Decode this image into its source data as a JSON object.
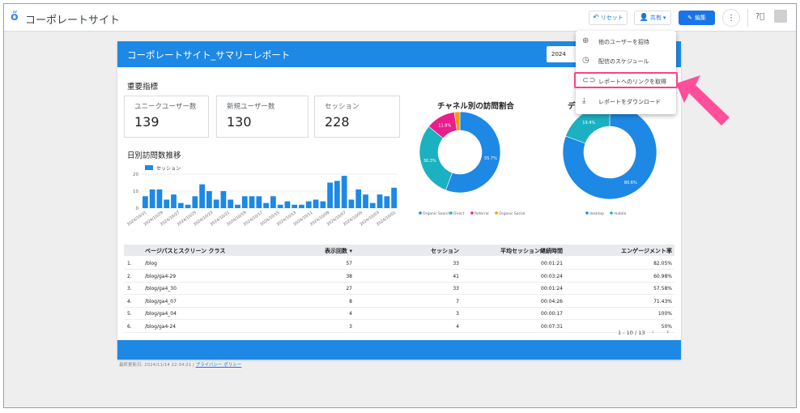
{
  "app": {
    "title": "コーポレートサイト"
  },
  "toolbar": {
    "reset_label": "リセット",
    "share_label": "共有",
    "edit_label": "編集"
  },
  "report": {
    "title": "コーポレートサイト_サマリーレポート",
    "date_prefix": "2024",
    "kpi_section": "重要指標",
    "kpis": [
      {
        "label": "ユニークユーザー数",
        "value": "139"
      },
      {
        "label": "新規ユーザー数",
        "value": "130"
      },
      {
        "label": "セッション",
        "value": "228"
      }
    ],
    "daily_title": "日別訪問数推移",
    "channel_title": "チャネル別の訪問割合",
    "device_title_partial": "デ",
    "last_updated": "最終更新日: 2024/11/14 22:34:21",
    "privacy_link": "プライバシー ポリシー"
  },
  "chart_data": [
    {
      "type": "bar",
      "title": "日別訪問数推移",
      "legend": [
        "セッション"
      ],
      "ylim": [
        0,
        20
      ],
      "yticks": [
        0,
        10,
        20
      ],
      "x_tick_labels": [
        "2024/10/31",
        "2024/10/29",
        "2024/10/27",
        "2024/10/25",
        "2024/10/23",
        "2024/10/21",
        "2024/10/19",
        "2024/10/17",
        "2024/10/15",
        "2024/10/13",
        "2024/10/11",
        "2024/10/09",
        "2024/10/07",
        "2024/10/05",
        "2024/10/03",
        "2024/10/01"
      ],
      "values": [
        7,
        11,
        11,
        5,
        8,
        3,
        2,
        7,
        14,
        10,
        5,
        10,
        5,
        2,
        7,
        7,
        7,
        3,
        7,
        2,
        4,
        2,
        2,
        4,
        5,
        4,
        15,
        16,
        19,
        5,
        11,
        8,
        3,
        8,
        7,
        12
      ],
      "color": "#1e88e5"
    },
    {
      "type": "pie",
      "title": "チャネル別の訪問割合",
      "labels": [
        "Organic Search",
        "Direct",
        "Referral",
        "Organic Social"
      ],
      "values": [
        55.7,
        30.3,
        11.8,
        2.2
      ],
      "data_labels": [
        "55.7%",
        "30.3%",
        "11.8%",
        ""
      ],
      "colors": [
        "#1e88e5",
        "#1bb1c0",
        "#e91e8c",
        "#ff9800"
      ]
    },
    {
      "type": "pie",
      "title": "デ",
      "labels": [
        "desktop",
        "mobile"
      ],
      "values": [
        80.6,
        19.4
      ],
      "data_labels": [
        "80.6%",
        "19.4%"
      ],
      "colors": [
        "#1e88e5",
        "#1bb1c0"
      ]
    }
  ],
  "table": {
    "headers": [
      "ページパスとスクリーン クラス",
      "表示回数 ▾",
      "セッション",
      "平均セッション継続時間",
      "エンゲージメント率"
    ],
    "rows": [
      {
        "n": "1.",
        "path": "/blog",
        "views": "57",
        "sessions": "33",
        "avg": "00:01:21",
        "eng": "82.05%"
      },
      {
        "n": "2.",
        "path": "/blog/ga4-29",
        "views": "38",
        "sessions": "41",
        "avg": "00:03:24",
        "eng": "60.98%"
      },
      {
        "n": "3.",
        "path": "/blog/ga4_30",
        "views": "27",
        "sessions": "33",
        "avg": "00:01:24",
        "eng": "57.58%"
      },
      {
        "n": "4.",
        "path": "/blog/ga4_07",
        "views": "8",
        "sessions": "7",
        "avg": "00:04:26",
        "eng": "71.43%"
      },
      {
        "n": "5.",
        "path": "/blog/ga4_04",
        "views": "4",
        "sessions": "3",
        "avg": "00:00:17",
        "eng": "100%"
      },
      {
        "n": "6.",
        "path": "/blog/ga4-24",
        "views": "3",
        "sessions": "4",
        "avg": "00:07:31",
        "eng": "50%"
      }
    ],
    "pager": "1 - 10 / 13"
  },
  "share_menu": {
    "items": [
      {
        "label": "他のユーザーを招待",
        "icon": "add-person-icon"
      },
      {
        "label": "配信のスケジュール",
        "icon": "clock-icon"
      },
      {
        "label": "レポートへのリンクを取得",
        "icon": "link-icon"
      },
      {
        "label": "レポートをダウンロード",
        "icon": "download-icon"
      }
    ]
  },
  "colors": {
    "brand_blue": "#1e88e5",
    "accent_blue": "#1a73e8",
    "highlight": "#ff4081"
  }
}
